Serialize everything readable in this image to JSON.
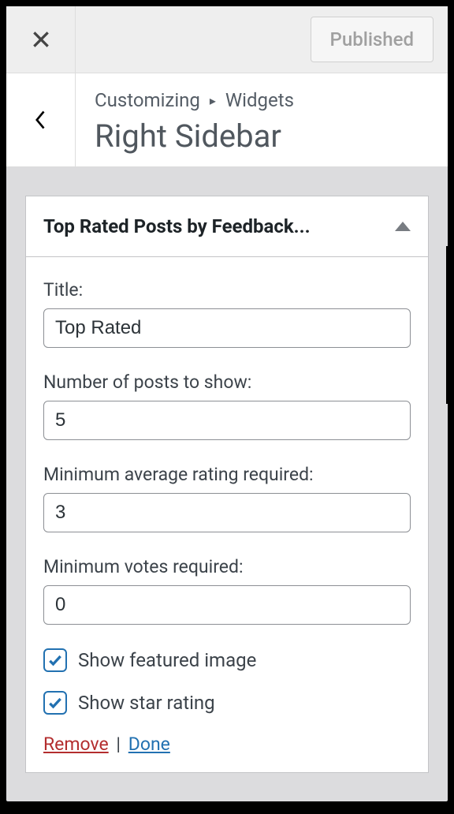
{
  "topbar": {
    "published_label": "Published"
  },
  "header": {
    "breadcrumb_root": "Customizing",
    "breadcrumb_section": "Widgets",
    "title": "Right Sidebar"
  },
  "widget": {
    "title": "Top Rated Posts by Feedback...",
    "fields": {
      "title_label": "Title:",
      "title_value": "Top Rated",
      "count_label": "Number of posts to show:",
      "count_value": "5",
      "minrating_label": "Minimum average rating required:",
      "minrating_value": "3",
      "minvotes_label": "Minimum votes required:",
      "minvotes_value": "0",
      "show_featured_label": "Show featured image",
      "show_featured_checked": true,
      "show_star_label": "Show star rating",
      "show_star_checked": true
    },
    "actions": {
      "remove": "Remove",
      "done": "Done"
    }
  }
}
